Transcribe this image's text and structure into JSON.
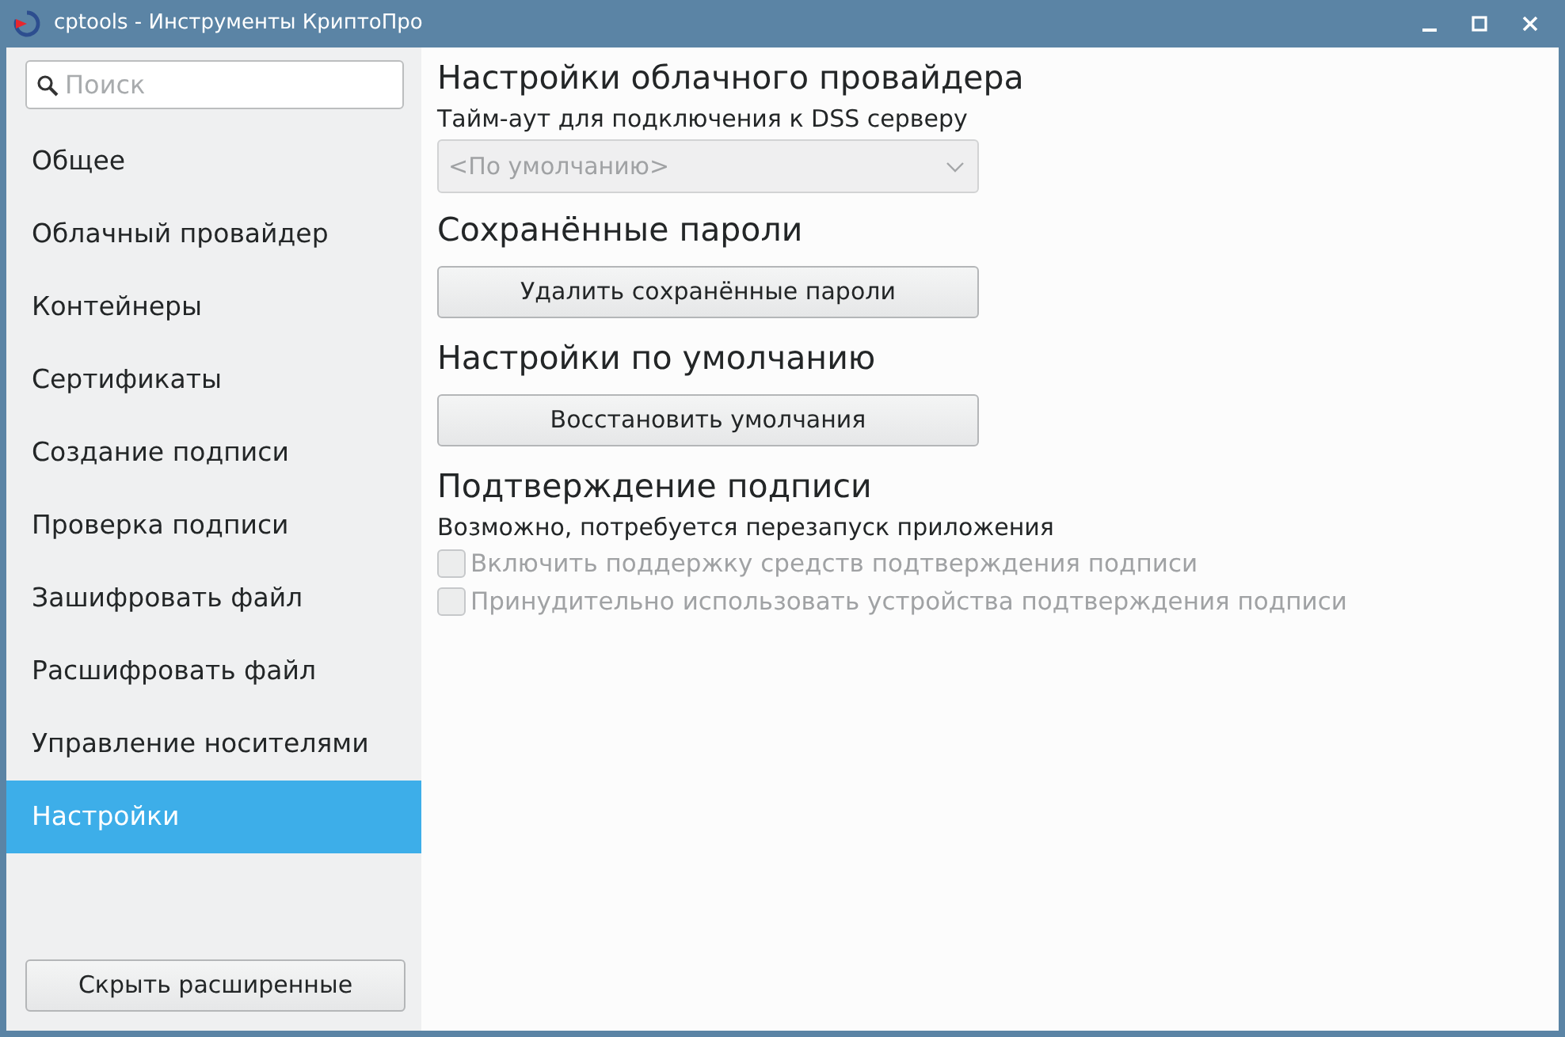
{
  "window": {
    "title": "cptools - Инструменты КриптоПро"
  },
  "sidebar": {
    "search": {
      "placeholder": "Поиск"
    },
    "items": [
      {
        "label": "Общее",
        "selected": false
      },
      {
        "label": "Облачный провайдер",
        "selected": false
      },
      {
        "label": "Контейнеры",
        "selected": false
      },
      {
        "label": "Сертификаты",
        "selected": false
      },
      {
        "label": "Создание подписи",
        "selected": false
      },
      {
        "label": "Проверка подписи",
        "selected": false
      },
      {
        "label": "Зашифровать файл",
        "selected": false
      },
      {
        "label": "Расшифровать файл",
        "selected": false
      },
      {
        "label": "Управление носителями",
        "selected": false
      },
      {
        "label": "Настройки",
        "selected": true
      }
    ],
    "footer_button": "Скрыть расширенные"
  },
  "sections": [
    {
      "heading": "Настройки облачного провайдера",
      "items": [
        {
          "kind": "label",
          "text": "Тайм-аут для подключения к DSS серверу"
        },
        {
          "kind": "select",
          "value": "<По умолчанию>",
          "disabled": true
        }
      ]
    },
    {
      "heading": "Сохранённые пароли",
      "items": [
        {
          "kind": "button",
          "text": "Удалить сохранённые пароли"
        }
      ]
    },
    {
      "heading": "Настройки по умолчанию",
      "items": [
        {
          "kind": "button",
          "text": "Восстановить умолчания"
        }
      ]
    },
    {
      "heading": "Подтверждение подписи",
      "items": [
        {
          "kind": "label",
          "text": "Возможно, потребуется перезапуск приложения"
        },
        {
          "kind": "checkbox",
          "text": "Включить поддержку средств подтверждения подписи",
          "checked": false,
          "disabled": true
        },
        {
          "kind": "checkbox",
          "text": "Принудительно использовать устройства подтверждения подписи",
          "checked": false,
          "disabled": true
        }
      ]
    }
  ]
}
